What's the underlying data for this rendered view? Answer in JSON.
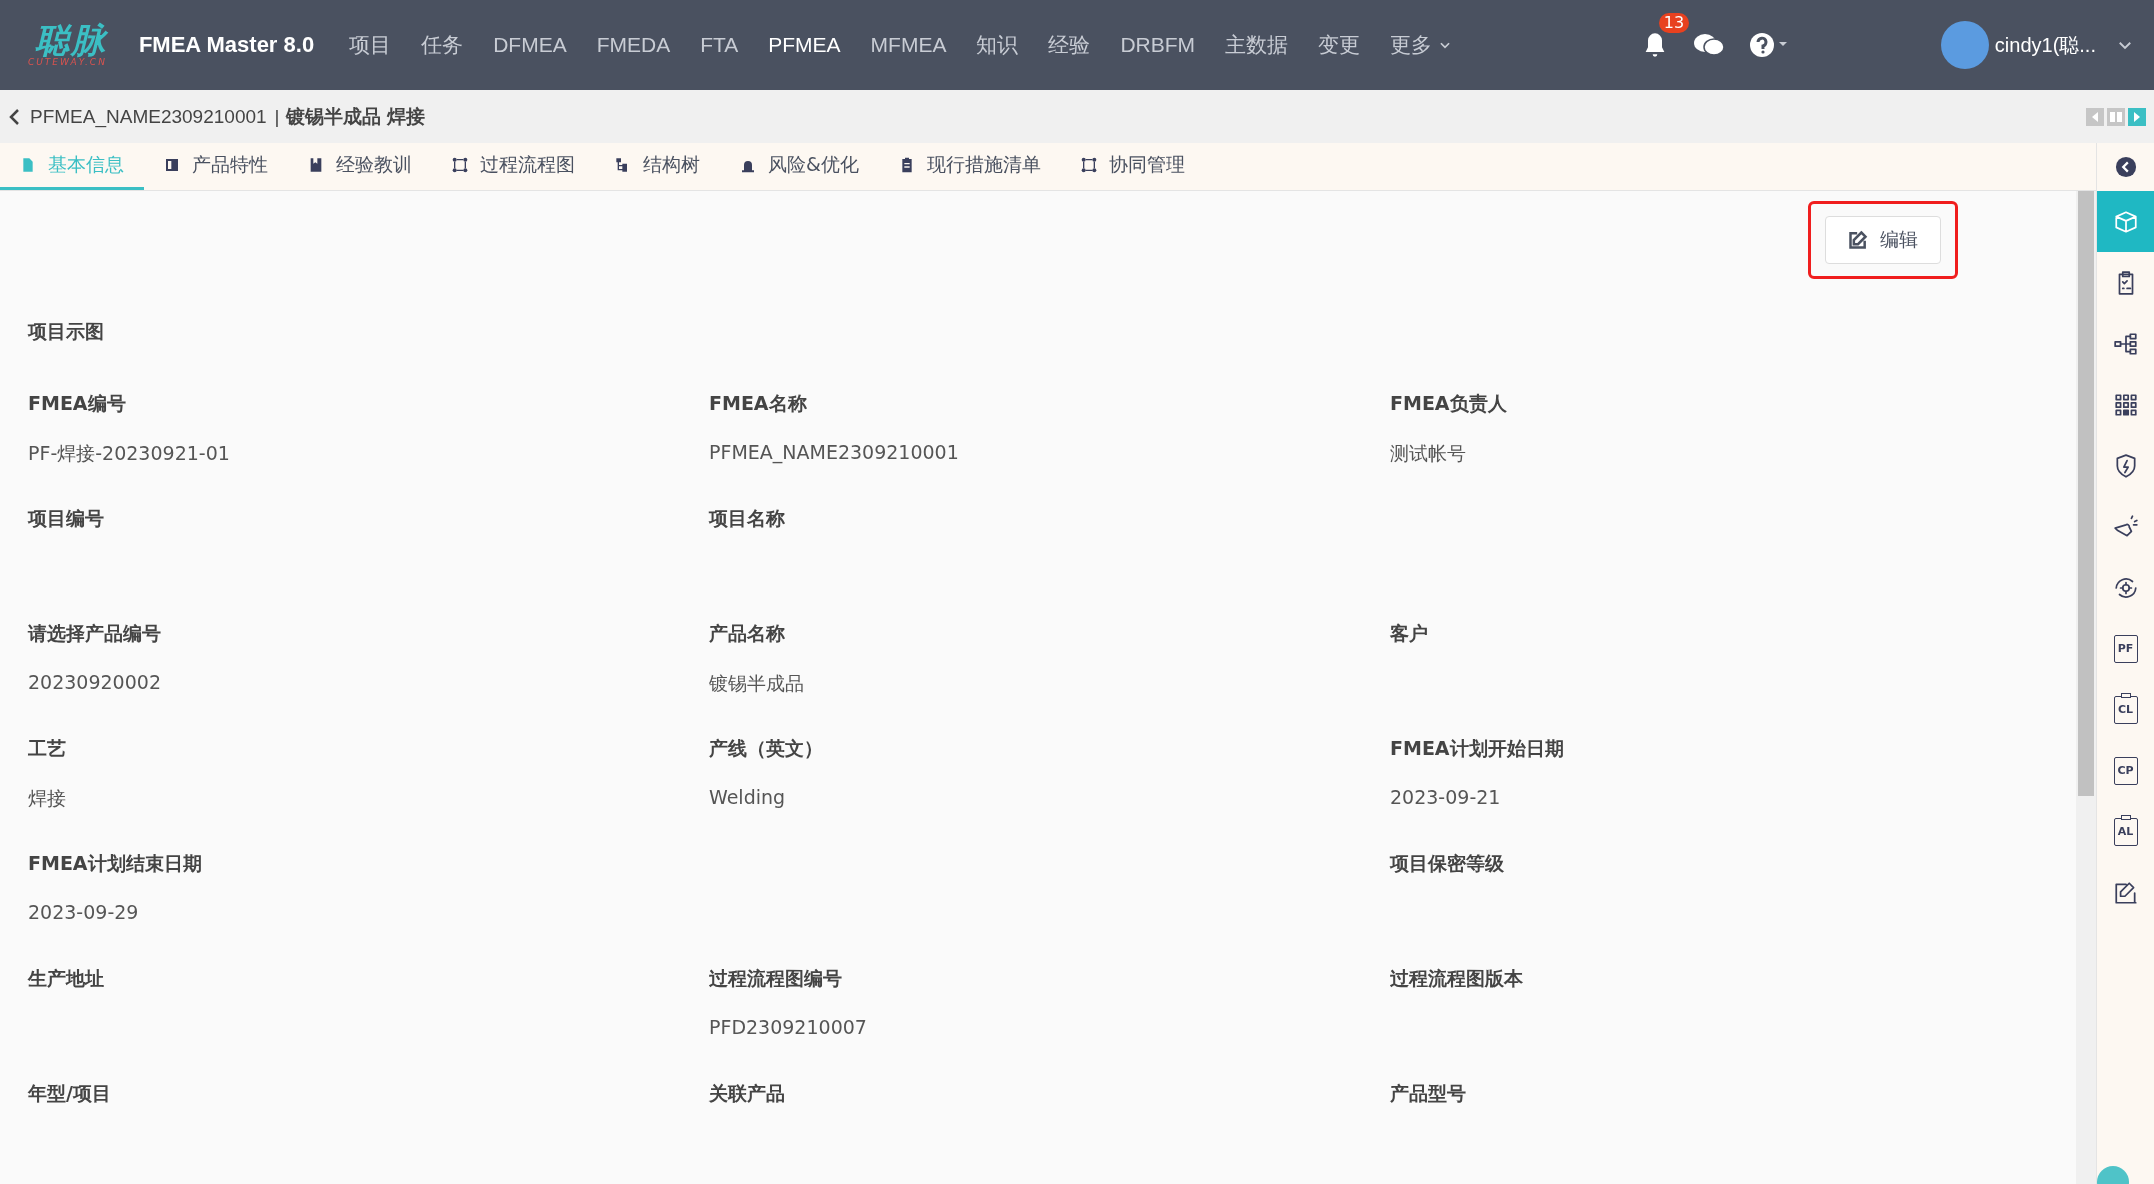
{
  "logo": {
    "mark": "聪脉",
    "domain": "CUTEWAY.CN"
  },
  "app_title": "FMEA Master 8.0",
  "nav": [
    {
      "label": "项目",
      "selected": false
    },
    {
      "label": "任务",
      "selected": false
    },
    {
      "label": "DFMEA",
      "selected": false
    },
    {
      "label": "FMEDA",
      "selected": false
    },
    {
      "label": "FTA",
      "selected": false
    },
    {
      "label": "PFMEA",
      "selected": true
    },
    {
      "label": "MFMEA",
      "selected": false
    },
    {
      "label": "知识",
      "selected": false
    },
    {
      "label": "经验",
      "selected": false
    },
    {
      "label": "DRBFM",
      "selected": false
    },
    {
      "label": "主数据",
      "selected": false
    },
    {
      "label": "变更",
      "selected": false
    },
    {
      "label": "更多",
      "selected": false,
      "dropdown": true
    }
  ],
  "notifications": {
    "count": "13"
  },
  "user": {
    "name": "cindy1(聪..."
  },
  "breadcrumb": {
    "doc": "PFMEA_NAME2309210001",
    "separator": "|",
    "title": "镀锡半成品 焊接"
  },
  "tabs": [
    {
      "label": "基本信息",
      "selected": true,
      "kind": "doc"
    },
    {
      "label": "产品特性",
      "selected": false,
      "kind": "panel"
    },
    {
      "label": "经验教训",
      "selected": false,
      "kind": "book"
    },
    {
      "label": "过程流程图",
      "selected": false,
      "kind": "nodes"
    },
    {
      "label": "结构树",
      "selected": false,
      "kind": "tree"
    },
    {
      "label": "风险&优化",
      "selected": false,
      "kind": "alarm"
    },
    {
      "label": "现行措施清单",
      "selected": false,
      "kind": "clipboard"
    },
    {
      "label": "协同管理",
      "selected": false,
      "kind": "nodes"
    }
  ],
  "edit_button": {
    "label": "编辑",
    "highlighted": true
  },
  "section_title": "项目示图",
  "rows": [
    {
      "cells": [
        {
          "kind": "field",
          "label": "FMEA编号",
          "value": "PF-焊接-20230921-01"
        },
        {
          "kind": "field",
          "label": "FMEA名称",
          "value": "PFMEA_NAME2309210001"
        },
        {
          "kind": "field",
          "label": "FMEA负责人",
          "value": "测试帐号"
        }
      ]
    },
    {
      "cells": [
        {
          "kind": "field",
          "label": "项目编号"
        },
        {
          "kind": "field",
          "label": "项目名称"
        },
        {
          "kind": "empty"
        }
      ]
    },
    {
      "cells": [
        {
          "kind": "field",
          "label": "请选择产品编号",
          "value": "20230920002"
        },
        {
          "kind": "field",
          "label": "产品名称",
          "value": "镀锡半成品"
        },
        {
          "kind": "field",
          "label": "客户"
        }
      ]
    },
    {
      "cells": [
        {
          "kind": "field",
          "label": "工艺",
          "value": "焊接"
        },
        {
          "kind": "field",
          "label": "产线（英文）",
          "value": "Welding"
        },
        {
          "kind": "field",
          "label": "FMEA计划开始日期",
          "value": "2023-09-21"
        }
      ]
    },
    {
      "cells": [
        {
          "kind": "field",
          "label": "FMEA计划结束日期",
          "value": "2023-09-29"
        },
        {
          "kind": "empty"
        },
        {
          "kind": "field",
          "label": "项目保密等级"
        }
      ]
    },
    {
      "cells": [
        {
          "kind": "field",
          "label": "生产地址"
        },
        {
          "kind": "field",
          "label": "过程流程图编号",
          "value": "PFD2309210007"
        },
        {
          "kind": "field",
          "label": "过程流程图版本"
        }
      ]
    },
    {
      "cells": [
        {
          "kind": "field",
          "label": "年型/项目"
        },
        {
          "kind": "field",
          "label": "关联产品"
        },
        {
          "kind": "field",
          "label": "产品型号"
        }
      ]
    }
  ],
  "side_tools": [
    {
      "kind": "box",
      "selected": true
    },
    {
      "kind": "checklist",
      "selected": false
    },
    {
      "kind": "tree",
      "selected": false
    },
    {
      "kind": "grid",
      "selected": false
    },
    {
      "kind": "shield",
      "selected": false
    },
    {
      "kind": "hand",
      "selected": false
    },
    {
      "kind": "gear",
      "selected": false
    },
    {
      "kind": "doc",
      "label": "PF",
      "selected": false
    },
    {
      "kind": "clip",
      "label": "CL",
      "selected": false
    },
    {
      "kind": "doc",
      "label": "CP",
      "selected": false
    },
    {
      "kind": "clip",
      "label": "AL",
      "selected": false
    },
    {
      "kind": "edit",
      "selected": false
    }
  ]
}
